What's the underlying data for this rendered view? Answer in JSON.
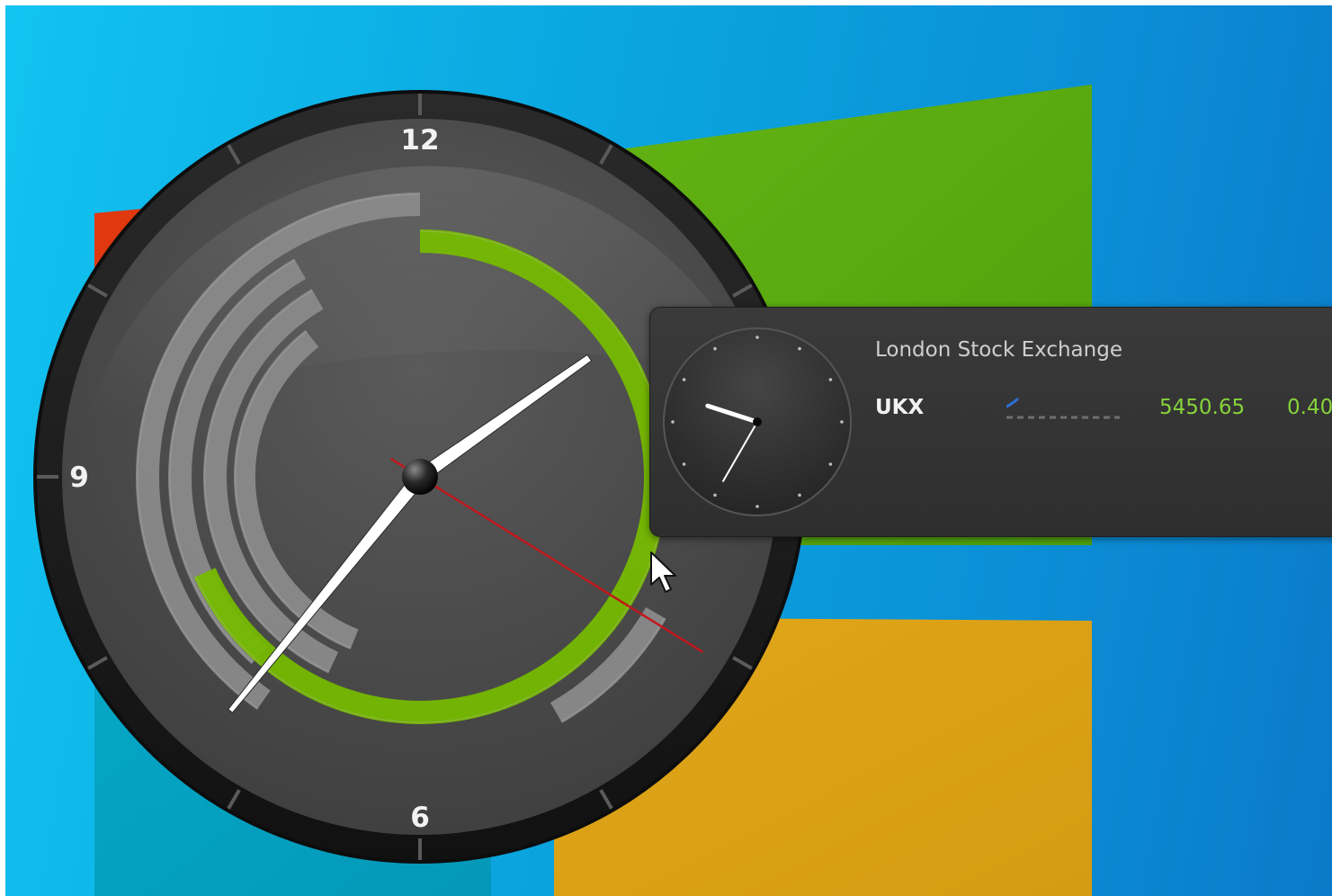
{
  "clock": {
    "numbers": {
      "twelve": "12",
      "nine": "9",
      "six": "6"
    },
    "time": {
      "hour": 1.83,
      "minute": 36.5,
      "second": 20.3
    },
    "colors": {
      "face": "#4a4a4a",
      "bezel": "#1c1c1c",
      "gray_arc": "#8a8a8a",
      "green_arc": "#76b900",
      "second_hand": "#c0181c"
    }
  },
  "popup": {
    "exchange_name": "London Stock Exchange",
    "mini_clock_time": {
      "hour": 9.6,
      "minute": 35.0
    },
    "ticker": {
      "symbol": "UKX",
      "price": "5450.65",
      "change": "0.40"
    },
    "colors": {
      "price_positive": "#86d33a",
      "sparkline": "#2d6fd1"
    }
  },
  "desktop": {
    "background": "windows-logo-wallpaper",
    "logo_colors": {
      "red": "#e0380f",
      "green": "#5aa80e",
      "blue": "#06a5c4",
      "yellow": "#dba318"
    }
  },
  "cursor": {
    "type": "arrow-pointer"
  }
}
